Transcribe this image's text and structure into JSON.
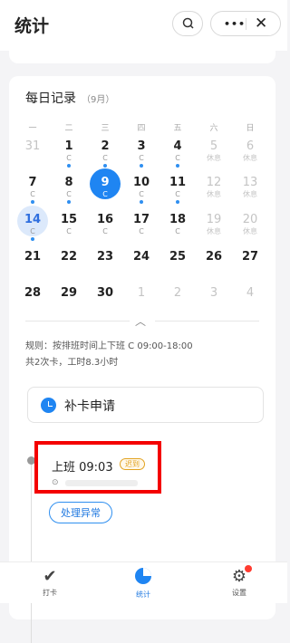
{
  "header": {
    "title": "统计",
    "more_label": "•••",
    "close_label": "✕"
  },
  "record": {
    "title": "每日记录",
    "month": "（9月）"
  },
  "weekdays": [
    "一",
    "二",
    "三",
    "四",
    "五",
    "六",
    "日"
  ],
  "rows": [
    [
      {
        "n": "31",
        "s": "",
        "off": true
      },
      {
        "n": "1",
        "s": "C",
        "dot": true
      },
      {
        "n": "2",
        "s": "C",
        "dot": true
      },
      {
        "n": "3",
        "s": "C",
        "dot": true
      },
      {
        "n": "4",
        "s": "C",
        "dot": true
      },
      {
        "n": "5",
        "s": "休息",
        "off": true
      },
      {
        "n": "6",
        "s": "休息",
        "off": true
      }
    ],
    [
      {
        "n": "7",
        "s": "C",
        "dot": true
      },
      {
        "n": "8",
        "s": "C",
        "dot": true
      },
      {
        "n": "9",
        "s": "C",
        "dot": true,
        "sel": true
      },
      {
        "n": "10",
        "s": "C",
        "dot": true
      },
      {
        "n": "11",
        "s": "C",
        "dot": true
      },
      {
        "n": "12",
        "s": "休息",
        "off": true
      },
      {
        "n": "13",
        "s": "休息",
        "off": true
      }
    ],
    [
      {
        "n": "14",
        "s": "C",
        "dot": true,
        "today": true
      },
      {
        "n": "15",
        "s": "C"
      },
      {
        "n": "16",
        "s": "C"
      },
      {
        "n": "17",
        "s": "C"
      },
      {
        "n": "18",
        "s": "C"
      },
      {
        "n": "19",
        "s": "休息",
        "off": true
      },
      {
        "n": "20",
        "s": "休息",
        "off": true
      }
    ],
    [
      {
        "n": "21",
        "s": ""
      },
      {
        "n": "22",
        "s": ""
      },
      {
        "n": "23",
        "s": ""
      },
      {
        "n": "24",
        "s": ""
      },
      {
        "n": "25",
        "s": ""
      },
      {
        "n": "26",
        "s": ""
      },
      {
        "n": "27",
        "s": ""
      }
    ],
    [
      {
        "n": "28",
        "s": ""
      },
      {
        "n": "29",
        "s": ""
      },
      {
        "n": "30",
        "s": ""
      },
      {
        "n": "1",
        "s": "",
        "off": true
      },
      {
        "n": "2",
        "s": "",
        "off": true
      },
      {
        "n": "3",
        "s": "",
        "off": true
      },
      {
        "n": "4",
        "s": "",
        "off": true
      }
    ]
  ],
  "rule": {
    "line1": "规则：按排班时间上下班 C 09:00-18:00",
    "line2": "共2次卡，工时8.3小时"
  },
  "patch": {
    "label": "补卡申请"
  },
  "punch": {
    "time": "上班 09:03",
    "status": "迟到"
  },
  "handle_button": "处理异常",
  "nav": [
    {
      "label": "打卡"
    },
    {
      "label": "统计"
    },
    {
      "label": "设置"
    }
  ],
  "colors": {
    "accent": "#1f85f2",
    "late": "#e2a21f",
    "highlight_box": "#f40000"
  }
}
